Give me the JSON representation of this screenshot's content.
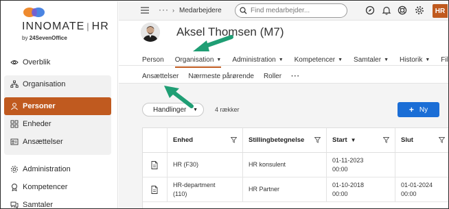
{
  "brand": {
    "name_left": "INNOMATE",
    "name_right": "HR",
    "by_prefix": "by",
    "by_company": "24SevenOffice"
  },
  "sidebar": {
    "items": [
      {
        "label": "Overblik",
        "icon": "eye-icon"
      },
      {
        "label": "Organisation",
        "icon": "org-chart-icon"
      },
      {
        "label": "Personer",
        "icon": "person-icon"
      },
      {
        "label": "Enheder",
        "icon": "grid-icon"
      },
      {
        "label": "Ansættelser",
        "icon": "id-card-icon"
      },
      {
        "label": "Administration",
        "icon": "gear-icon"
      },
      {
        "label": "Kompetencer",
        "icon": "badge-icon"
      },
      {
        "label": "Samtaler",
        "icon": "chat-icon"
      }
    ],
    "active_index": 2
  },
  "topbar": {
    "breadcrumb": "Medarbejdere",
    "more": "···",
    "search_placeholder": "Find medarbejder...",
    "badge": "HR"
  },
  "person": {
    "name": "Aksel Thomsen (M7)"
  },
  "main_tabs": [
    {
      "label": "Person",
      "dropdown": false
    },
    {
      "label": "Organisation",
      "dropdown": true
    },
    {
      "label": "Administration",
      "dropdown": true
    },
    {
      "label": "Kompetencer",
      "dropdown": true
    },
    {
      "label": "Samtaler",
      "dropdown": true
    },
    {
      "label": "Historik",
      "dropdown": true
    },
    {
      "label": "Filan",
      "dropdown": false
    }
  ],
  "sub_tabs": [
    {
      "label": "Ansættelser"
    },
    {
      "label": "Nærmeste pårørende"
    },
    {
      "label": "Roller"
    },
    {
      "label": "···"
    }
  ],
  "toolbar": {
    "actions_label": "Handlinger",
    "rows_count": "4 rækker",
    "new_label": "Ny"
  },
  "table": {
    "columns": [
      "Enhed",
      "Stillingbetegnelse",
      "Start",
      "Slut"
    ],
    "rows": [
      {
        "enhed": "HR (F30)",
        "stilling": "HR konsulent",
        "start": "01-11-2023 00:00",
        "slut": ""
      },
      {
        "enhed": "HR-department (110)",
        "stilling": "HR Partner",
        "start": "01-10-2018 00:00",
        "slut": "01-01-2024 00:00"
      }
    ]
  },
  "colors": {
    "accent": "#c05a1f",
    "primary_button": "#1b6ed6",
    "arrow": "#1f9e74"
  }
}
